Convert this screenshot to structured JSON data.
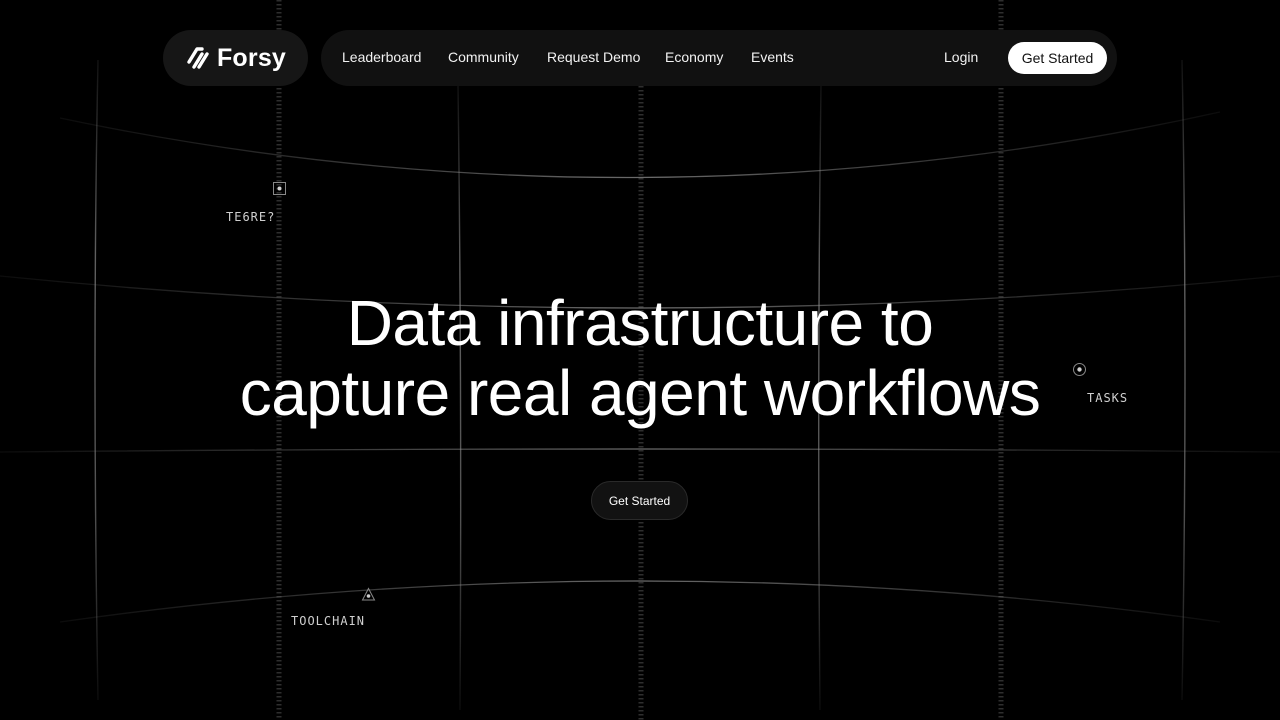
{
  "brand": {
    "name": "Forsy",
    "logo_icon": "forsy-logo-icon"
  },
  "nav": {
    "items": [
      {
        "label": "Leaderboard"
      },
      {
        "label": "Community"
      },
      {
        "label": "Request Demo"
      },
      {
        "label": "Economy"
      },
      {
        "label": "Events"
      }
    ],
    "login_label": "Login",
    "cta_label": "Get Started"
  },
  "hero": {
    "title_line1": "Data infrastructure to",
    "title_line2": "capture real agent workflows",
    "cta_label": "Get Started"
  },
  "markers": [
    {
      "label": "TE6RE?",
      "icon": "square-target-icon"
    },
    {
      "label": "TASKS",
      "icon": "circle-target-icon"
    },
    {
      "label": "TOOLCHAIN",
      "icon": "triangle-target-icon"
    }
  ],
  "colors": {
    "background": "#000000",
    "nav_background": "#111111",
    "accent_button": "#ffffff",
    "grid_line": "#5a5a5a"
  }
}
